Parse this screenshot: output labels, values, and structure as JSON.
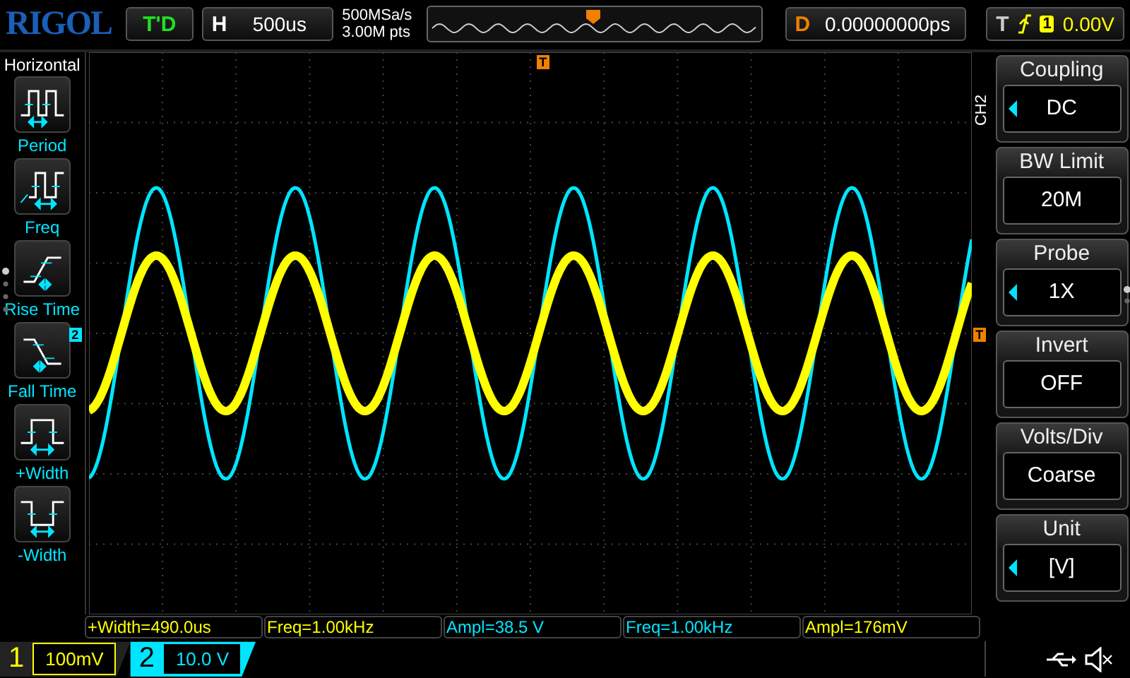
{
  "top_bar": {
    "brand": "RIGOL",
    "run_state": "T'D",
    "horizontal": {
      "label": "H",
      "value": "500us"
    },
    "sample_rate": "500MSa/s",
    "memory_depth": "3.00M pts",
    "delay": {
      "label": "D",
      "value": "0.00000000ps"
    },
    "trigger": {
      "label": "T",
      "source": "1",
      "level": "0.00V"
    }
  },
  "left_menu": {
    "title": "Horizontal",
    "items": [
      {
        "kind": "period",
        "label": "Period"
      },
      {
        "kind": "freq",
        "label": "Freq"
      },
      {
        "kind": "rise",
        "label": "Rise Time"
      },
      {
        "kind": "fall",
        "label": "Fall Time"
      },
      {
        "kind": "pwidth",
        "label": "+Width"
      },
      {
        "kind": "nwidth",
        "label": "-Width"
      }
    ]
  },
  "markers": {
    "channel": "2",
    "trigger_top": "T",
    "trigger_level": "T"
  },
  "right_menu": {
    "channel": "CH2",
    "items": [
      {
        "title": "Coupling",
        "value": "DC",
        "adjustable": true
      },
      {
        "title": "BW Limit",
        "value": "20M",
        "adjustable": false
      },
      {
        "title": "Probe",
        "value": "1X",
        "adjustable": true
      },
      {
        "title": "Invert",
        "value": "OFF",
        "adjustable": false
      },
      {
        "title": "Volts/Div",
        "value": "Coarse",
        "adjustable": false
      },
      {
        "title": "Unit",
        "value": "[V]",
        "adjustable": true
      }
    ]
  },
  "measurements": [
    {
      "text": "+Width=490.0us",
      "color": "#ffff00"
    },
    {
      "text": "Freq=1.00kHz",
      "color": "#ffff00"
    },
    {
      "text": "Ampl=38.5 V",
      "color": "#00e5ff"
    },
    {
      "text": "Freq=1.00kHz",
      "color": "#00e5ff"
    },
    {
      "text": "Ampl=176mV",
      "color": "#ffff00"
    }
  ],
  "channels": [
    {
      "number": "1",
      "scale": "100mV",
      "selected": false,
      "color": "#ffff00"
    },
    {
      "number": "2",
      "scale": "10.0 V",
      "selected": true,
      "color": "#00e5ff"
    }
  ]
}
